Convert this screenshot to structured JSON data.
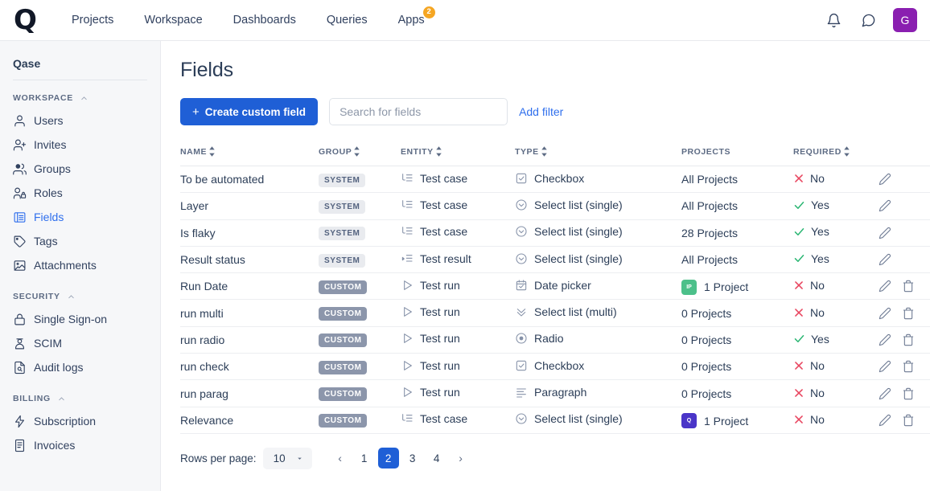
{
  "topnav": {
    "logo": "Q",
    "items": [
      {
        "label": "Projects",
        "badge": null
      },
      {
        "label": "Workspace",
        "badge": null
      },
      {
        "label": "Dashboards",
        "badge": null
      },
      {
        "label": "Queries",
        "badge": null
      },
      {
        "label": "Apps",
        "badge": "2"
      }
    ],
    "notifications_icon": "bell-icon",
    "chat_icon": "chat-bubble-icon",
    "avatar_initial": "G",
    "avatar_color": "#8a1fb0",
    "badge_color": "#f5a623"
  },
  "sidebar": {
    "title": "Qase",
    "groups": [
      {
        "label": "WORKSPACE",
        "items": [
          {
            "label": "Users",
            "icon": "user-icon",
            "active": false
          },
          {
            "label": "Invites",
            "icon": "user-plus-icon",
            "active": false
          },
          {
            "label": "Groups",
            "icon": "users-group-icon",
            "active": false
          },
          {
            "label": "Roles",
            "icon": "user-lock-icon",
            "active": false
          },
          {
            "label": "Fields",
            "icon": "fields-list-icon",
            "active": true
          },
          {
            "label": "Tags",
            "icon": "tag-icon",
            "active": false
          },
          {
            "label": "Attachments",
            "icon": "image-icon",
            "active": false
          }
        ]
      },
      {
        "label": "SECURITY",
        "items": [
          {
            "label": "Single Sign-on",
            "icon": "lock-icon",
            "active": false
          },
          {
            "label": "SCIM",
            "icon": "scim-user-icon",
            "active": false
          },
          {
            "label": "Audit logs",
            "icon": "document-search-icon",
            "active": false
          }
        ]
      },
      {
        "label": "BILLING",
        "items": [
          {
            "label": "Subscription",
            "icon": "lightning-icon",
            "active": false
          },
          {
            "label": "Invoices",
            "icon": "invoice-icon",
            "active": false
          }
        ]
      }
    ]
  },
  "main": {
    "page_title": "Fields",
    "create_button": "Create custom field",
    "create_button_plus": "+",
    "search_placeholder": "Search for fields",
    "search_value": "",
    "add_filter": "Add filter",
    "accent_color": "#1f5fd6"
  },
  "table": {
    "columns": [
      {
        "key": "name",
        "label": "NAME",
        "sortable": true
      },
      {
        "key": "group",
        "label": "GROUP",
        "sortable": true
      },
      {
        "key": "entity",
        "label": "ENTITY",
        "sortable": true
      },
      {
        "key": "type",
        "label": "TYPE",
        "sortable": true
      },
      {
        "key": "projects",
        "label": "PROJECTS",
        "sortable": false
      },
      {
        "key": "required",
        "label": "REQUIRED",
        "sortable": true
      },
      {
        "key": "actions",
        "label": "",
        "sortable": false
      }
    ],
    "rows": [
      {
        "name": "To be automated",
        "group": "SYSTEM",
        "entity": "Test case",
        "entity_icon": "test-case-icon",
        "type": "Checkbox",
        "type_icon": "checkbox-icon",
        "projects": "All Projects",
        "project_badge": null,
        "required": "No",
        "required_bool": false,
        "can_delete": false
      },
      {
        "name": "Layer",
        "group": "SYSTEM",
        "entity": "Test case",
        "entity_icon": "test-case-icon",
        "type": "Select list (single)",
        "type_icon": "select-single-icon",
        "projects": "All Projects",
        "project_badge": null,
        "required": "Yes",
        "required_bool": true,
        "can_delete": false
      },
      {
        "name": "Is flaky",
        "group": "SYSTEM",
        "entity": "Test case",
        "entity_icon": "test-case-icon",
        "type": "Select list (single)",
        "type_icon": "select-single-icon",
        "projects": "28 Projects",
        "project_badge": null,
        "required": "Yes",
        "required_bool": true,
        "can_delete": false
      },
      {
        "name": "Result status",
        "group": "SYSTEM",
        "entity": "Test result",
        "entity_icon": "test-result-icon",
        "type": "Select list (single)",
        "type_icon": "select-single-icon",
        "projects": "All Projects",
        "project_badge": null,
        "required": "Yes",
        "required_bool": true,
        "can_delete": false
      },
      {
        "name": "Run Date",
        "group": "CUSTOM",
        "entity": "Test run",
        "entity_icon": "test-run-icon",
        "type": "Date picker",
        "type_icon": "calendar-icon",
        "projects": "1 Project",
        "project_badge": {
          "text": "IP",
          "color": "#4cc08a"
        },
        "required": "No",
        "required_bool": false,
        "can_delete": true
      },
      {
        "name": "run multi",
        "group": "CUSTOM",
        "entity": "Test run",
        "entity_icon": "test-run-icon",
        "type": "Select list (multi)",
        "type_icon": "select-multi-icon",
        "projects": "0 Projects",
        "project_badge": null,
        "required": "No",
        "required_bool": false,
        "can_delete": true
      },
      {
        "name": "run radio",
        "group": "CUSTOM",
        "entity": "Test run",
        "entity_icon": "test-run-icon",
        "type": "Radio",
        "type_icon": "radio-icon",
        "projects": "0 Projects",
        "project_badge": null,
        "required": "Yes",
        "required_bool": true,
        "can_delete": true
      },
      {
        "name": "run check",
        "group": "CUSTOM",
        "entity": "Test run",
        "entity_icon": "test-run-icon",
        "type": "Checkbox",
        "type_icon": "checkbox-icon",
        "projects": "0 Projects",
        "project_badge": null,
        "required": "No",
        "required_bool": false,
        "can_delete": true
      },
      {
        "name": "run parag",
        "group": "CUSTOM",
        "entity": "Test run",
        "entity_icon": "test-run-icon",
        "type": "Paragraph",
        "type_icon": "paragraph-icon",
        "projects": "0 Projects",
        "project_badge": null,
        "required": "No",
        "required_bool": false,
        "can_delete": true
      },
      {
        "name": "Relevance",
        "group": "CUSTOM",
        "entity": "Test case",
        "entity_icon": "test-case-icon",
        "type": "Select list (single)",
        "type_icon": "select-single-icon",
        "projects": "1 Project",
        "project_badge": {
          "text": "Q",
          "color": "#4a35c8"
        },
        "required": "No",
        "required_bool": false,
        "can_delete": true
      }
    ]
  },
  "pagination": {
    "rows_per_page_label": "Rows per page:",
    "rows_per_page_value": "10",
    "prev": "‹",
    "next": "›",
    "pages": [
      "1",
      "2",
      "3",
      "4"
    ],
    "active_page": "2"
  }
}
